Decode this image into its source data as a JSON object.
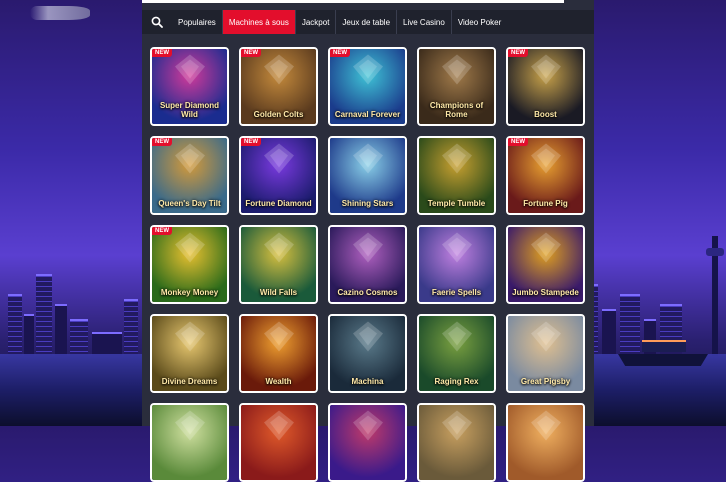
{
  "nav": {
    "search_icon": "search-icon",
    "tabs": [
      {
        "label": "Populaires",
        "active": false
      },
      {
        "label": "Machines à sous",
        "active": true
      },
      {
        "label": "Jackpot",
        "active": false
      },
      {
        "label": "Jeux de table",
        "active": false
      },
      {
        "label": "Live Casino",
        "active": false
      },
      {
        "label": "Video Poker",
        "active": false
      }
    ]
  },
  "badge_label": "NEW",
  "colors": {
    "accent": "#e30e2c",
    "panel": "#2a2d3c",
    "navbar": "#1f222d"
  },
  "games": [
    {
      "title": "Super Diamond Wild",
      "new": true,
      "bg": [
        "#1a2c8f",
        "#d23a9a"
      ]
    },
    {
      "title": "Golden Colts",
      "new": true,
      "bg": [
        "#5a3a1e",
        "#c48a3c"
      ]
    },
    {
      "title": "Carnaval Forever",
      "new": true,
      "bg": [
        "#1b3c8c",
        "#3fc3d6"
      ]
    },
    {
      "title": "Champions of Rome",
      "new": false,
      "bg": [
        "#3a2a1a",
        "#a07a4a"
      ]
    },
    {
      "title": "Boost",
      "new": true,
      "bg": [
        "#1a1a24",
        "#c8a24a"
      ]
    },
    {
      "title": "Queen's Day Tilt",
      "new": true,
      "bg": [
        "#3a6a8a",
        "#d49a3a"
      ]
    },
    {
      "title": "Fortune Diamond",
      "new": true,
      "bg": [
        "#1c1c6e",
        "#7a3ae0"
      ]
    },
    {
      "title": "Shining Stars",
      "new": false,
      "bg": [
        "#1e3a8a",
        "#8ad0e8"
      ]
    },
    {
      "title": "Temple Tumble",
      "new": false,
      "bg": [
        "#2a4a1a",
        "#c8a030"
      ]
    },
    {
      "title": "Fortune Pig",
      "new": true,
      "bg": [
        "#6a1a1a",
        "#e8a030"
      ]
    },
    {
      "title": "Monkey Money",
      "new": true,
      "bg": [
        "#2a6a1a",
        "#e8c030"
      ]
    },
    {
      "title": "Wild Falls",
      "new": false,
      "bg": [
        "#1a5a3a",
        "#d8c040"
      ]
    },
    {
      "title": "Cazino Cosmos",
      "new": false,
      "bg": [
        "#2a1a5a",
        "#b060c0"
      ]
    },
    {
      "title": "Faerie Spells",
      "new": false,
      "bg": [
        "#3a3a8a",
        "#c080e0"
      ]
    },
    {
      "title": "Jumbo Stampede",
      "new": false,
      "bg": [
        "#3a1a6a",
        "#e0a020"
      ]
    },
    {
      "title": "Divine Dreams",
      "new": false,
      "bg": [
        "#5a4a1a",
        "#e8c870"
      ]
    },
    {
      "title": "Wealth",
      "new": false,
      "bg": [
        "#6a1a0a",
        "#f0a030"
      ]
    },
    {
      "title": "Machina",
      "new": false,
      "bg": [
        "#1a2a3a",
        "#5a7a8a"
      ]
    },
    {
      "title": "Raging Rex",
      "new": false,
      "bg": [
        "#1a4a2a",
        "#7aa040"
      ]
    },
    {
      "title": "Great Pigsby",
      "new": false,
      "bg": [
        "#7a8aa0",
        "#e0c090"
      ]
    },
    {
      "title": "",
      "new": false,
      "bg": [
        "#5a8a3a",
        "#d0e0a0"
      ]
    },
    {
      "title": "",
      "new": false,
      "bg": [
        "#8a1a1a",
        "#e05a2a"
      ]
    },
    {
      "title": "",
      "new": false,
      "bg": [
        "#3a1a8a",
        "#c03a6a"
      ]
    },
    {
      "title": "",
      "new": false,
      "bg": [
        "#6a5a3a",
        "#c8a060"
      ]
    },
    {
      "title": "",
      "new": false,
      "bg": [
        "#a05a2a",
        "#f0b060"
      ]
    }
  ]
}
